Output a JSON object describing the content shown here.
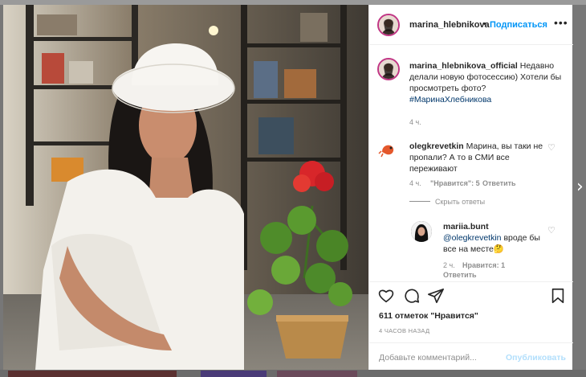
{
  "post": {
    "author": "marina_hlebnikova",
    "follow_label": "Подписаться",
    "dot": "•",
    "more": "•••"
  },
  "caption": {
    "author": "marina_hlebnikova_official",
    "text": " Недавно делали новую фотосессию) Хотели бы просмотреть фото? ",
    "hashtag": "#МаринаХлебникова",
    "time": "4 ч."
  },
  "comments": [
    {
      "author": "olegkrevetkin",
      "text": " Марина, вы таки не пропали? А то в СМИ все переживают",
      "time": "4 ч.",
      "likes": "\"Нравится\": 5",
      "reply_label": "Ответить",
      "hide_replies": "Скрыть ответы"
    },
    {
      "author": "mariia.bunt",
      "mention": "@olegkrevetkin",
      "text": " вроде бы все на месте🤔",
      "time": "2 ч.",
      "likes": "Нравится: 1",
      "reply_label": "Ответить"
    }
  ],
  "actions": {
    "likes_count": "611 отметок \"Нравится\"",
    "time_ago": "4 ЧАСОВ НАЗАД"
  },
  "comment_box": {
    "placeholder": "Добавьте комментарий...",
    "publish_label": "Опубликовать"
  },
  "nav": {
    "next_arrow": "›"
  },
  "colors": {
    "accent": "#0095f6",
    "link": "#00376b",
    "muted": "#8e8e8e"
  }
}
